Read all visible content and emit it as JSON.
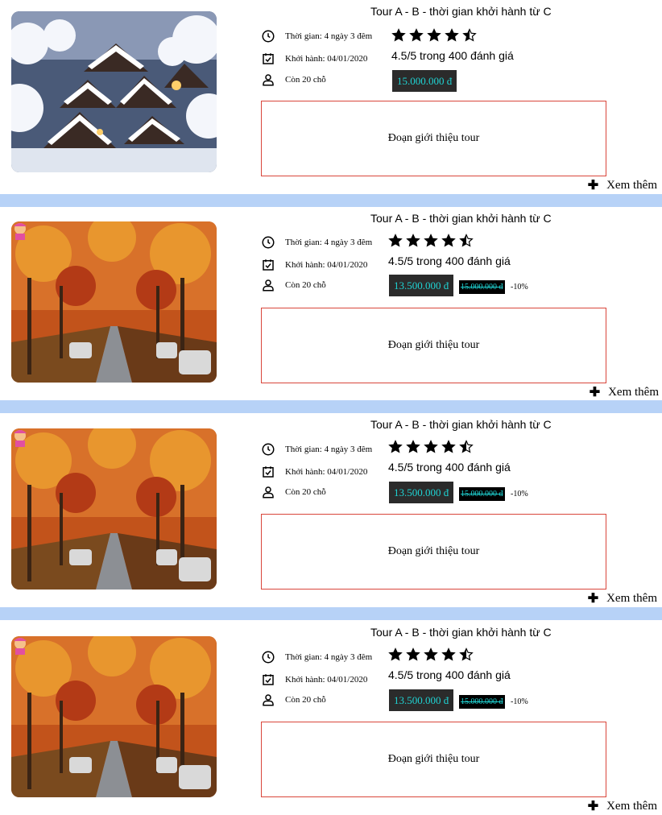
{
  "colors": {
    "divider": "#b7d2f7",
    "price_bg": "#2b2b2b",
    "price_text": "#1fd3d3",
    "intro_border": "#d9463b"
  },
  "tours": [
    {
      "image": "snow-village-photo",
      "title": "Tour A - B - thời gian khởi hành từ C",
      "duration": "Thời gian: 4 ngày 3 đêm",
      "departure": "Khởi hành: 04/01/2020",
      "seats": "Còn 20 chỗ",
      "rating_value": 4.5,
      "rating_text": "4.5/5 trong 400 đánh giá",
      "price": "15.000.000 đ",
      "old_price": "",
      "discount": "",
      "intro": "Đoạn giới thiệu tour",
      "more_label": "Xem thêm"
    },
    {
      "image": "autumn-road-photo",
      "title": "Tour A - B - thời gian khởi hành từ C",
      "duration": "Thời gian: 4 ngày 3 đêm",
      "departure": "Khởi hành: 04/01/2020",
      "seats": "Còn 20 chỗ",
      "rating_value": 4.5,
      "rating_text": "4.5/5 trong 400 đánh giá",
      "price": "13.500.000 đ",
      "old_price": "15.000.000 đ",
      "discount": "-10%",
      "intro": "Đoạn giới thiệu tour",
      "more_label": "Xem thêm"
    },
    {
      "image": "autumn-road-photo",
      "title": "Tour A - B - thời gian khởi hành từ C",
      "duration": "Thời gian: 4 ngày 3 đêm",
      "departure": "Khởi hành: 04/01/2020",
      "seats": "Còn 20 chỗ",
      "rating_value": 4.5,
      "rating_text": "4.5/5 trong 400 đánh giá",
      "price": "13.500.000 đ",
      "old_price": "15.000.000 đ",
      "discount": "-10%",
      "intro": "Đoạn giới thiệu tour",
      "more_label": "Xem thêm"
    },
    {
      "image": "autumn-road-photo",
      "title": "Tour A - B - thời gian khởi hành từ C",
      "duration": "Thời gian: 4 ngày 3 đêm",
      "departure": "Khởi hành: 04/01/2020",
      "seats": "Còn 20 chỗ",
      "rating_value": 4.5,
      "rating_text": "4.5/5 trong 400 đánh giá",
      "price": "13.500.000 đ",
      "old_price": "15.000.000 đ",
      "discount": "-10%",
      "intro": "Đoạn giới thiệu tour",
      "more_label": "Xem thêm"
    }
  ]
}
